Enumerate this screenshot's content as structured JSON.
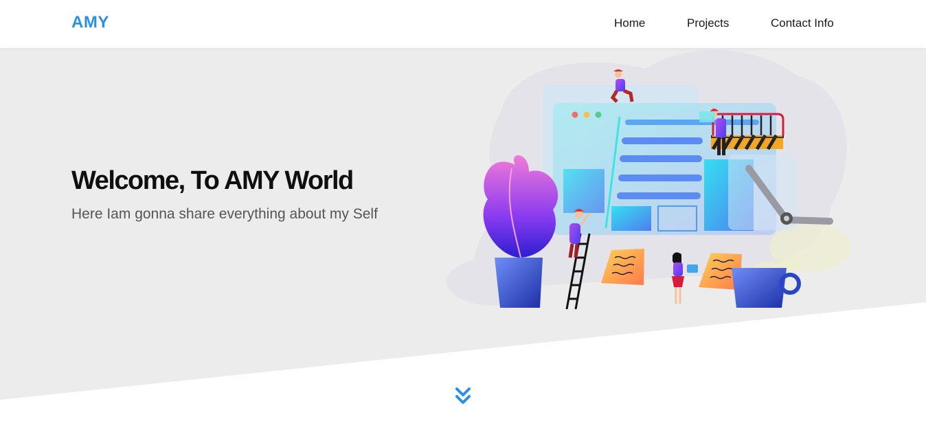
{
  "nav": {
    "brand": "AMY",
    "links": [
      "Home",
      "Projects",
      "Contact Info"
    ]
  },
  "hero": {
    "title": "Welcome, To AMY World",
    "subtitle": "Here Iam gonna share everything about my Self"
  },
  "colors": {
    "accent": "#2a8fe6",
    "hero_bg": "#ececec"
  },
  "icons": {
    "scroll": "double-chevron-down-icon"
  }
}
